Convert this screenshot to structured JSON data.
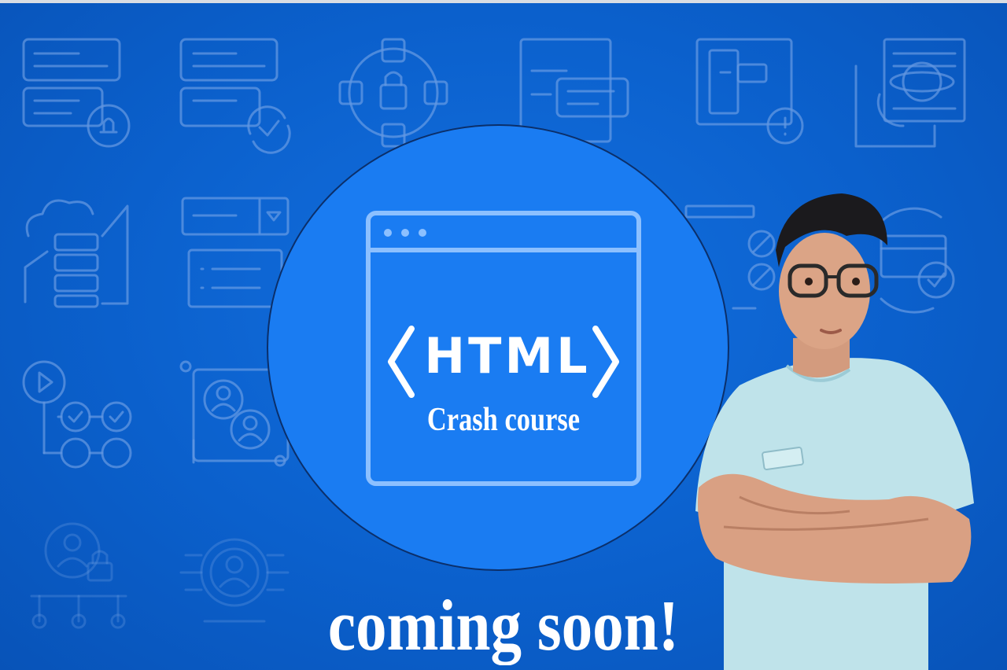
{
  "hero": {
    "tag_text": "HTML",
    "subtitle": "Crash course",
    "announcement": "coming soon!"
  },
  "colors": {
    "background": "#0b60cc",
    "circle": "#1a7cf2",
    "icon_outline": "#7fa9e8",
    "text": "#ffffff"
  },
  "decorative_icons": [
    "notification-form-icon",
    "refresh-form-icon",
    "security-network-icon",
    "document-card-icon",
    "alert-layout-icon",
    "web-settings-icon",
    "cloud-server-icon",
    "dropdown-list-icon",
    "play-workflow-icon",
    "user-settings-icon",
    "user-lock-icon",
    "user-network-icon"
  ]
}
